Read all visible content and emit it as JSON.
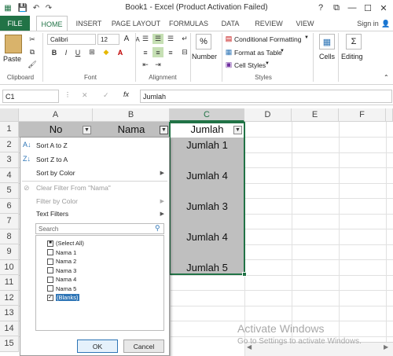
{
  "window": {
    "title": "Book1 -  Excel (Product Activation Failed)",
    "help": "?",
    "restore": "⧉",
    "minimize": "—",
    "maximize": "☐",
    "close": "✕",
    "sign_in": "Sign in"
  },
  "quick_access": {
    "save_icon": "save-icon",
    "undo_icon": "undo-icon",
    "redo_icon": "redo-icon"
  },
  "tabs": [
    "FILE",
    "HOME",
    "INSERT",
    "PAGE LAYOUT",
    "FORMULAS",
    "DATA",
    "REVIEW",
    "VIEW"
  ],
  "ribbon": {
    "clipboard": {
      "label": "Clipboard",
      "paste": "Paste"
    },
    "font": {
      "label": "Font",
      "name": "Calibri",
      "size": "12",
      "bold": "B",
      "italic": "I",
      "underline": "U",
      "grow": "A",
      "shrink": "A"
    },
    "alignment": {
      "label": "Alignment"
    },
    "number": {
      "label": "Number",
      "percent": "%"
    },
    "styles": {
      "label": "Styles",
      "conditional": "Conditional Formatting",
      "table": "Format as Table",
      "cell_styles": "Cell Styles"
    },
    "cells": {
      "label": "Cells"
    },
    "editing": {
      "label": "Editing"
    }
  },
  "formula_bar": {
    "name_box": "C1",
    "fx": "fx",
    "value": "Jumlah",
    "cancel": "✕",
    "enter": "✓"
  },
  "columns": [
    "A",
    "B",
    "C",
    "D",
    "E",
    "F"
  ],
  "rows": [
    "1",
    "2",
    "3",
    "4",
    "5",
    "6",
    "7",
    "8",
    "9",
    "10",
    "11",
    "12",
    "13",
    "14",
    "15"
  ],
  "headers": {
    "a": "No",
    "b": "Nama",
    "c": "Jumlah"
  },
  "column_c": [
    "Jumlah 1",
    "Jumlah 4",
    "Jumlah 3",
    "Jumlah 4",
    "Jumlah 5"
  ],
  "filter_menu": {
    "sort_az": "Sort A to Z",
    "sort_za": "Sort Z to A",
    "sort_color": "Sort by Color",
    "clear_filter": "Clear Filter From \"Nama\"",
    "filter_color": "Filter by Color",
    "text_filters": "Text Filters",
    "search_placeholder": "Search",
    "items": [
      {
        "label": "(Select All)",
        "checked": "partial"
      },
      {
        "label": "Nama 1",
        "checked": false
      },
      {
        "label": "Nama 2",
        "checked": false
      },
      {
        "label": "Nama 3",
        "checked": false
      },
      {
        "label": "Nama 4",
        "checked": false
      },
      {
        "label": "Nama 5",
        "checked": false
      },
      {
        "label": "(Blanks)",
        "checked": true
      }
    ],
    "ok": "OK",
    "cancel": "Cancel"
  },
  "watermark": {
    "line1": "Activate Windows",
    "line2": "Go to Settings to activate Windows."
  },
  "colors": {
    "excel_green": "#217346",
    "header_fill": "#bfbfbf",
    "selection": "#217346"
  }
}
